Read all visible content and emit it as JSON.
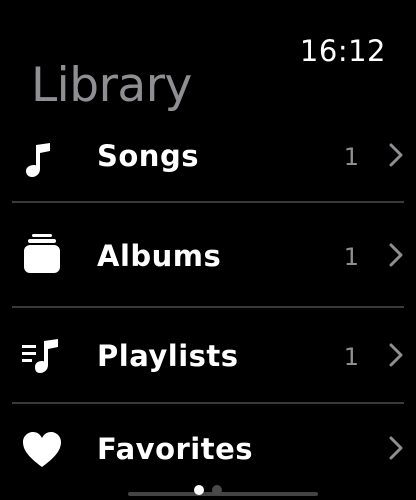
{
  "status": {
    "time": "16:12"
  },
  "header": {
    "title": "Library"
  },
  "list": {
    "items": [
      {
        "label": "Songs",
        "count": "1",
        "icon": "music-note-icon"
      },
      {
        "label": "Albums",
        "count": "1",
        "icon": "album-stack-icon"
      },
      {
        "label": "Playlists",
        "count": "1",
        "icon": "playlist-icon"
      },
      {
        "label": "Favorites",
        "count": "",
        "icon": "heart-icon"
      }
    ]
  },
  "pager": {
    "pages": 2,
    "current": 1
  },
  "colors": {
    "background": "#000000",
    "text": "#ffffff",
    "secondary": "#8e8e93",
    "separator": "#3a3a3c"
  }
}
